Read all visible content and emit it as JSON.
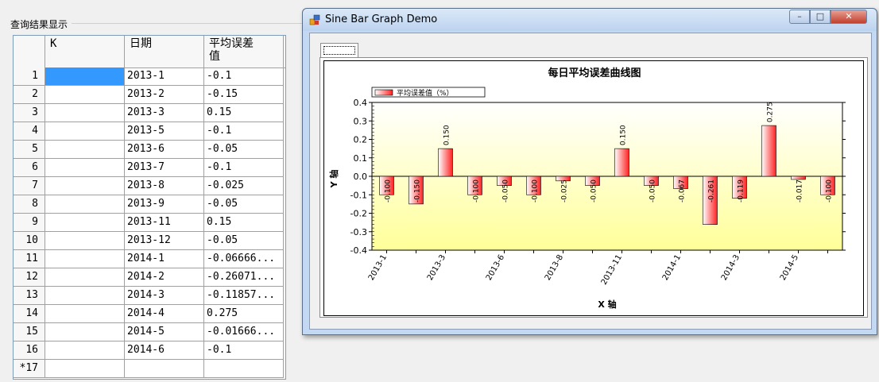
{
  "main": {
    "group_label": "查询结果显示",
    "grid": {
      "columns": [
        "K",
        "日期",
        "平均误差\n值"
      ],
      "rows": [
        {
          "num": "1",
          "k": "",
          "date": "2013-1",
          "value": "-0.1"
        },
        {
          "num": "2",
          "k": "",
          "date": "2013-2",
          "value": "-0.15"
        },
        {
          "num": "3",
          "k": "",
          "date": "2013-3",
          "value": "0.15"
        },
        {
          "num": "4",
          "k": "",
          "date": "2013-5",
          "value": "-0.1"
        },
        {
          "num": "5",
          "k": "",
          "date": "2013-6",
          "value": "-0.05"
        },
        {
          "num": "6",
          "k": "",
          "date": "2013-7",
          "value": "-0.1"
        },
        {
          "num": "7",
          "k": "",
          "date": "2013-8",
          "value": "-0.025"
        },
        {
          "num": "8",
          "k": "",
          "date": "2013-9",
          "value": "-0.05"
        },
        {
          "num": "9",
          "k": "",
          "date": "2013-11",
          "value": "0.15"
        },
        {
          "num": "10",
          "k": "",
          "date": "2013-12",
          "value": "-0.05"
        },
        {
          "num": "11",
          "k": "",
          "date": "2014-1",
          "value": "-0.06666..."
        },
        {
          "num": "12",
          "k": "",
          "date": "2014-2",
          "value": "-0.26071..."
        },
        {
          "num": "13",
          "k": "",
          "date": "2014-3",
          "value": "-0.11857..."
        },
        {
          "num": "14",
          "k": "",
          "date": "2014-4",
          "value": "0.275"
        },
        {
          "num": "15",
          "k": "",
          "date": "2014-5",
          "value": "-0.01666..."
        },
        {
          "num": "16",
          "k": "",
          "date": "2014-6",
          "value": "-0.1"
        },
        {
          "num": "*17",
          "k": "",
          "date": "",
          "value": ""
        }
      ]
    }
  },
  "chart_window": {
    "title": "Sine Bar Graph Demo",
    "minimize_glyph": "–",
    "maximize_glyph": "□",
    "close_glyph": "✕"
  },
  "chart_data": {
    "type": "bar",
    "title": "每日平均误差曲线图",
    "xlabel": "X 轴",
    "ylabel": "Y 轴",
    "ylim": [
      -0.4,
      0.4
    ],
    "yticks": [
      "0.4",
      "0.3",
      "0.2",
      "0.1",
      "0.0",
      "-0.1",
      "-0.2",
      "-0.3",
      "-0.4"
    ],
    "legend_position": "top-left",
    "bar_color": "#ff3333",
    "series": [
      {
        "name": "平均误差值（%）",
        "values": [
          -0.1,
          -0.15,
          0.15,
          -0.1,
          -0.05,
          -0.1,
          -0.025,
          -0.05,
          0.15,
          -0.05,
          -0.067,
          -0.261,
          -0.119,
          0.275,
          -0.017,
          -0.1
        ],
        "labels": [
          "-0.100",
          "-0.150",
          "0.150",
          "-0.100",
          "-0.050",
          "-0.100",
          "-0.025",
          "-0.050",
          "0.150",
          "-0.050",
          "-0.067",
          "-0.261",
          "-0.119",
          "0.275",
          "-0.017",
          "-0.100"
        ]
      }
    ],
    "categories": [
      "2013-1",
      "2013-2",
      "2013-3",
      "2013-5",
      "2013-6",
      "2013-7",
      "2013-8",
      "2013-9",
      "2013-11",
      "2013-12",
      "2014-1",
      "2014-2",
      "2014-3",
      "2014-4",
      "2014-5",
      "2014-6"
    ],
    "xtick_labels": [
      {
        "index": 0,
        "text": "2013-1"
      },
      {
        "index": 2,
        "text": "2013-3"
      },
      {
        "index": 4,
        "text": "2013-6"
      },
      {
        "index": 6,
        "text": "2013-8"
      },
      {
        "index": 8,
        "text": "2013-11"
      },
      {
        "index": 10,
        "text": "2014-1"
      },
      {
        "index": 12,
        "text": "2014-3"
      },
      {
        "index": 14,
        "text": "2014-5"
      }
    ]
  }
}
